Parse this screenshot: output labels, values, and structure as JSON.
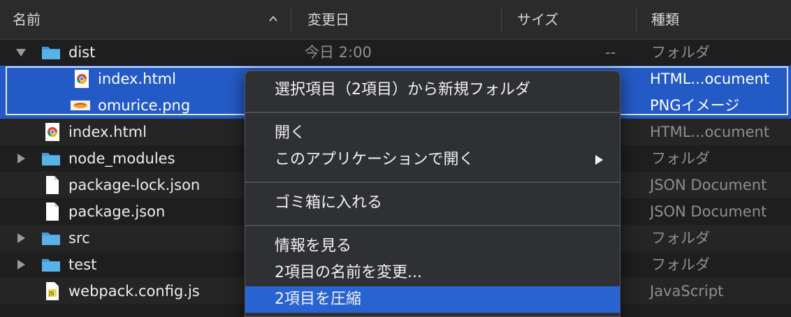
{
  "columns": {
    "name": "名前",
    "modified": "変更日",
    "size": "サイズ",
    "kind": "種類"
  },
  "rows": [
    {
      "name": "dist",
      "date": "今日 2:00",
      "size": "--",
      "kind": "フォルダ",
      "icon": "folder-icon",
      "disclosure": "open"
    },
    {
      "name": "index.html",
      "date": "",
      "size": "",
      "kind": "HTML...ocument",
      "icon": "chrome-html-icon",
      "selected": true
    },
    {
      "name": "omurice.png",
      "date": "",
      "size": "",
      "kind": "PNGイメージ",
      "icon": "image-thumbnail-icon",
      "selected": true
    },
    {
      "name": "index.html",
      "date": "",
      "size": "",
      "kind": "HTML...ocument",
      "icon": "chrome-html-icon"
    },
    {
      "name": "node_modules",
      "date": "",
      "size": "",
      "kind": "フォルダ",
      "icon": "folder-icon",
      "disclosure": "closed"
    },
    {
      "name": "package-lock.json",
      "date": "",
      "size": "",
      "kind": "JSON Document",
      "icon": "document-icon"
    },
    {
      "name": "package.json",
      "date": "",
      "size": "",
      "kind": "JSON Document",
      "icon": "document-icon"
    },
    {
      "name": "src",
      "date": "",
      "size": "",
      "kind": "フォルダ",
      "icon": "folder-icon",
      "disclosure": "closed"
    },
    {
      "name": "test",
      "date": "",
      "size": "",
      "kind": "フォルダ",
      "icon": "folder-icon",
      "disclosure": "closed"
    },
    {
      "name": "webpack.config.js",
      "date": "",
      "size": "",
      "kind": "JavaScript",
      "icon": "js-file-icon"
    }
  ],
  "context_menu": {
    "new_folder": "選択項目（2項目）から新規フォルダ",
    "open": "開く",
    "open_with": "このアプリケーションで開く",
    "trash": "ゴミ箱に入れる",
    "get_info": "情報を見る",
    "rename": "2項目の名前を変更...",
    "compress": "2項目を圧縮"
  },
  "colors": {
    "selection": "#245ac5",
    "menu_highlight": "#2864d1",
    "folder": "#3f9ad6"
  }
}
